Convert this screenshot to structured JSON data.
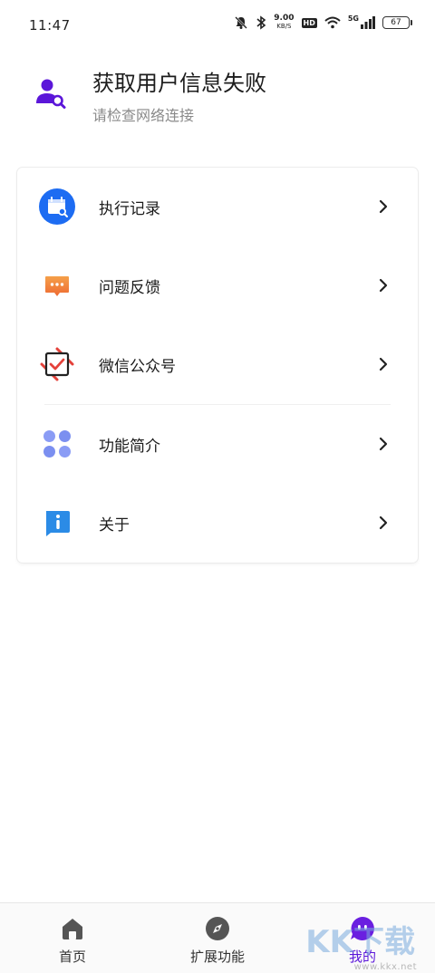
{
  "status_bar": {
    "time": "11:47",
    "net_speed": "9.00",
    "net_unit": "KB/S",
    "hd": "HD",
    "network": "5G",
    "battery": "67"
  },
  "user": {
    "title": "获取用户信息失败",
    "subtitle": "请检查网络连接",
    "accent": "#5b16d9"
  },
  "menu": {
    "items": [
      {
        "label": "执行记录",
        "icon": "calendar-search-icon",
        "color": "#1d6cf2"
      },
      {
        "label": "问题反馈",
        "icon": "chat-bubble-icon",
        "color": "#f07a3a"
      },
      {
        "label": "微信公众号",
        "icon": "checkbox-icon",
        "color": "#e4413a"
      },
      {
        "label": "功能简介",
        "icon": "four-petal-icon",
        "color": "#7b8ff0"
      },
      {
        "label": "关于",
        "icon": "info-bubble-icon",
        "color": "#2b8be6"
      }
    ]
  },
  "nav": {
    "items": [
      {
        "label": "首页",
        "icon": "home-icon"
      },
      {
        "label": "扩展功能",
        "icon": "compass-icon"
      },
      {
        "label": "我的",
        "icon": "chat-face-icon",
        "active": true
      }
    ]
  },
  "watermark": {
    "big": "KK下载",
    "url": "www.kkx.net"
  }
}
